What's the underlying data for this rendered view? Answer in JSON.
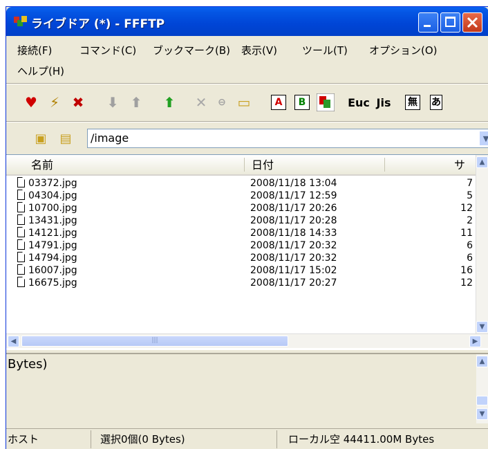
{
  "window": {
    "title": "ライブドア (*) - FFFTP"
  },
  "menu": [
    "接続(F)",
    "コマンド(C)",
    "ブックマーク(B)",
    "表示(V)",
    "ツール(T)",
    "オプション(O)",
    "ヘルプ(H)"
  ],
  "toolbar": {
    "items": [
      {
        "icon": "connect-icon"
      },
      {
        "icon": "quick-connect-icon"
      },
      {
        "icon": "disconnect-icon"
      },
      {
        "icon": "download-icon"
      },
      {
        "icon": "upload-icon"
      },
      {
        "icon": "mirror-upload-icon"
      },
      {
        "icon": "delete-icon"
      },
      {
        "icon": "rename-icon"
      },
      {
        "icon": "mkdir-icon"
      },
      {
        "icon": "ascii-mode-icon",
        "label": "A"
      },
      {
        "icon": "binary-mode-icon",
        "label": "B"
      },
      {
        "icon": "auto-mode-icon"
      },
      {
        "icon": "euc-icon",
        "label": "Euc"
      },
      {
        "icon": "jis-icon",
        "label": "Jis"
      },
      {
        "icon": "no-convert-icon",
        "label": "無"
      }
    ]
  },
  "path": {
    "value": "/image"
  },
  "columns": {
    "name": "名前",
    "date": "日付",
    "size": "サ"
  },
  "files": [
    {
      "name": "03372.jpg",
      "date": "2008/11/18 13:04",
      "size": "7"
    },
    {
      "name": "04304.jpg",
      "date": "2008/11/17 12:59",
      "size": "5"
    },
    {
      "name": "10700.jpg",
      "date": "2008/11/17 20:26",
      "size": "12"
    },
    {
      "name": "13431.jpg",
      "date": "2008/11/17 20:28",
      "size": "2"
    },
    {
      "name": "14121.jpg",
      "date": "2008/11/18 14:33",
      "size": "11"
    },
    {
      "name": "14791.jpg",
      "date": "2008/11/17 20:32",
      "size": "6"
    },
    {
      "name": "14794.jpg",
      "date": "2008/11/17 20:32",
      "size": "6"
    },
    {
      "name": "16007.jpg",
      "date": "2008/11/17 15:02",
      "size": "16"
    },
    {
      "name": "16675.jpg",
      "date": "2008/11/17 20:27",
      "size": "12"
    }
  ],
  "log": {
    "text": "Bytes)"
  },
  "status": {
    "host": "ホスト",
    "selection": "選択0個(0 Bytes)",
    "local_free": "ローカル空 44411.00M Bytes"
  }
}
